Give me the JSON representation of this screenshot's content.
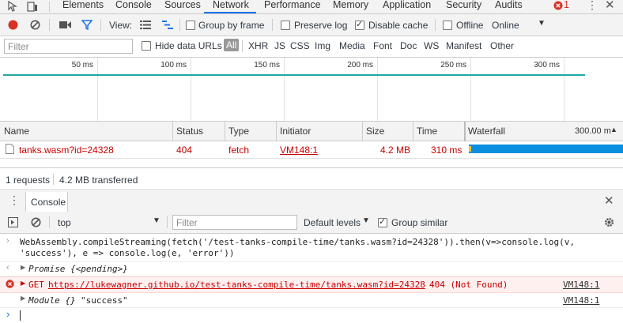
{
  "tabs": {
    "items": [
      "Elements",
      "Console",
      "Sources",
      "Network",
      "Performance",
      "Memory",
      "Application",
      "Security",
      "Audits"
    ],
    "error_count": "1"
  },
  "toolbar": {
    "view_label": "View:",
    "group_by_frame": "Group by frame",
    "preserve_log": "Preserve log",
    "disable_cache": "Disable cache",
    "offline": "Offline",
    "throttle": "Online"
  },
  "filterbar": {
    "filter_placeholder": "Filter",
    "hide_data_urls": "Hide data URLs",
    "types": [
      "All",
      "XHR",
      "JS",
      "CSS",
      "Img",
      "Media",
      "Font",
      "Doc",
      "WS",
      "Manifest",
      "Other"
    ]
  },
  "overview": {
    "ticks": [
      "50 ms",
      "100 ms",
      "150 ms",
      "200 ms",
      "250 ms",
      "300 ms"
    ]
  },
  "table": {
    "headers": {
      "name": "Name",
      "status": "Status",
      "type": "Type",
      "initiator": "Initiator",
      "size": "Size",
      "time": "Time",
      "waterfall": "Waterfall",
      "waterfall_scale": "300.00 m"
    },
    "rows": [
      {
        "name": "tanks.wasm?id=24328",
        "status": "404",
        "type": "fetch",
        "initiator": "VM148:1",
        "size": "4.2 MB",
        "time": "310 ms"
      }
    ]
  },
  "statusbar": {
    "requests": "1 requests",
    "transferred": "4.2 MB transferred"
  },
  "drawer": {
    "tab": "Console"
  },
  "console_toolbar": {
    "context": "top",
    "filter_placeholder": "Filter",
    "levels": "Default levels",
    "group_similar": "Group similar"
  },
  "console": {
    "input_line1": "WebAssembly.compileStreaming(fetch('/test-tanks-compile-time/tanks.wasm?id=24328')).then(v=>console.log(v,",
    "input_line2": "'success'), e => console.log(e, 'error'))",
    "promise": "Promise {<pending>}",
    "error_method": "GET",
    "error_url": "https://lukewagner.github.io/test-tanks-compile-time/tanks.wasm?id=24328",
    "error_status": "404 (Not Found)",
    "error_source": "VM148:1",
    "log_module": "Module {}",
    "log_success": "\"success\"",
    "log_source": "VM148:1"
  },
  "colors": {
    "accent": "#1a73e8",
    "error": "#c80000",
    "waterfall_bar": "#0a8fdf",
    "overview_line": "#1ea7a3"
  }
}
